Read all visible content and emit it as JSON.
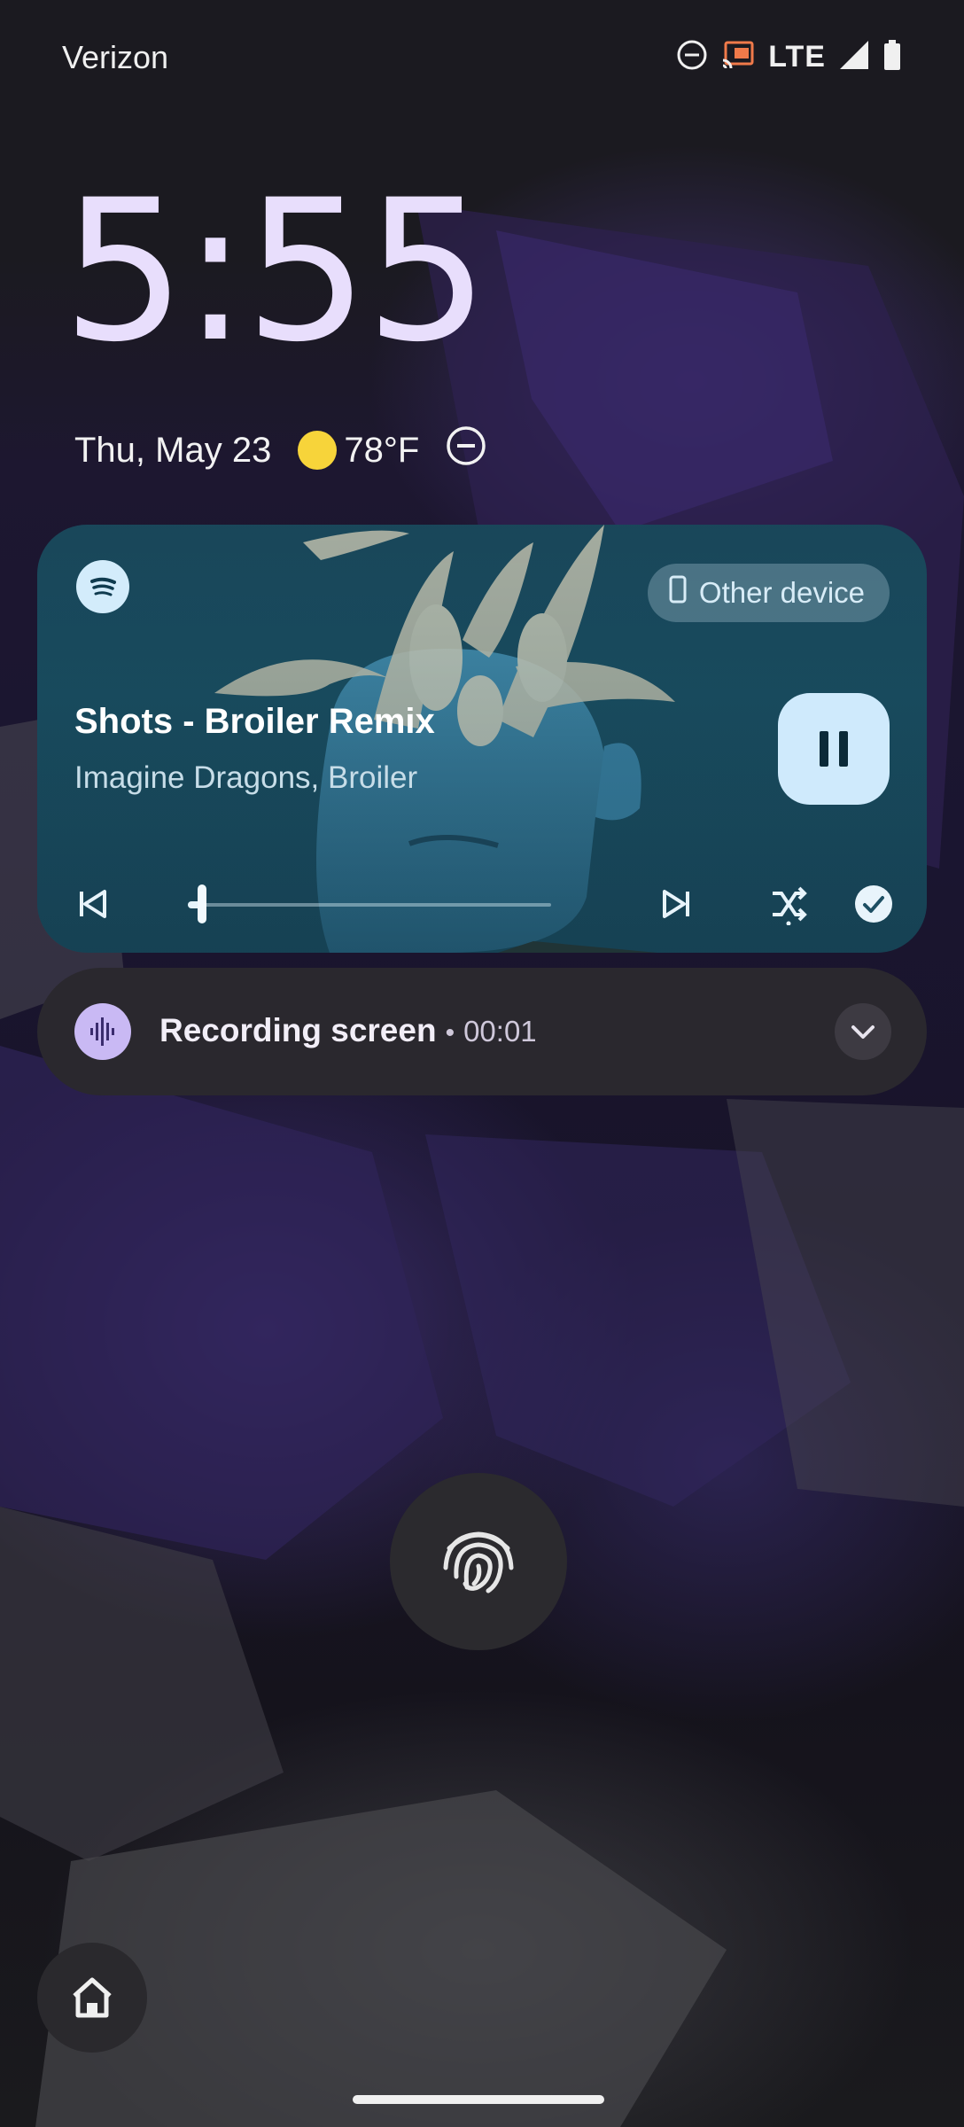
{
  "status_bar": {
    "carrier": "Verizon",
    "network": "LTE",
    "icons": [
      "do-not-disturb-icon",
      "cast-icon",
      "signal-icon",
      "battery-icon"
    ]
  },
  "lock_screen": {
    "time": "5:55",
    "date": "Thu, May 23",
    "weather": {
      "icon": "sun-icon",
      "temperature": "78°F"
    },
    "dnd_icon": "do-not-disturb-icon"
  },
  "media": {
    "app_icon": "spotify-icon",
    "output_device_label": "Other device",
    "title": "Shots - Broiler Remix",
    "artist": "Imagine Dragons, Broiler",
    "play_state": "playing",
    "progress": 0.04,
    "accent": "#cfeafc"
  },
  "notification": {
    "icon": "sound-wave-icon",
    "title": "Recording screen",
    "separator": "•",
    "elapsed": "00:01"
  },
  "bottom": {
    "fingerprint_icon": "fingerprint-icon",
    "home_icon": "home-icon"
  }
}
